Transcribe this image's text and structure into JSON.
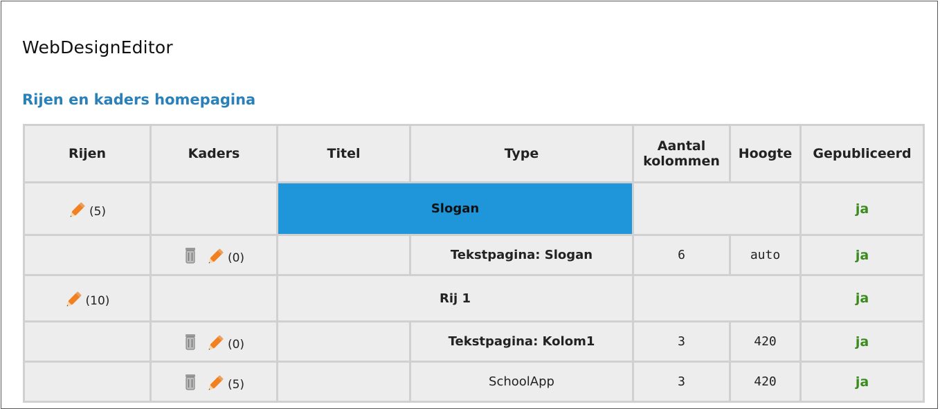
{
  "app": {
    "title": "WebDesignEditor"
  },
  "section": {
    "title": "Rijen en kaders homepagina"
  },
  "table": {
    "headers": {
      "rijen": "Rijen",
      "kaders": "Kaders",
      "titel": "Titel",
      "type": "Type",
      "aantal_line1": "Aantal",
      "aantal_line2": "kolommen",
      "hoogte": "Hoogte",
      "gepubliceerd": "Gepubliceerd"
    },
    "rows": [
      {
        "kind": "rij",
        "count": "(5)",
        "label": "Slogan",
        "gepubliceerd": "ja"
      },
      {
        "kind": "kader",
        "count": "(0)",
        "titel": "",
        "type": "Tekstpagina: Slogan",
        "kolommen": "6",
        "hoogte": "auto",
        "gepubliceerd": "ja"
      },
      {
        "kind": "rij",
        "count": "(10)",
        "label": "Rij 1",
        "gepubliceerd": "ja"
      },
      {
        "kind": "kader",
        "count": "(0)",
        "titel": "",
        "type": "Tekstpagina: Kolom1",
        "kolommen": "3",
        "hoogte": "420",
        "gepubliceerd": "ja"
      },
      {
        "kind": "kader",
        "count": "(5)",
        "titel": "",
        "type": "SchoolApp",
        "kolommen": "3",
        "hoogte": "420",
        "gepubliceerd": "ja"
      }
    ]
  },
  "icons": {
    "edit": "pencil-icon",
    "delete": "trash-icon"
  },
  "colors": {
    "highlight": "#1f96d9",
    "section_title": "#2a80b9",
    "published": "#3a8a1e",
    "pencil": "#f08020"
  }
}
